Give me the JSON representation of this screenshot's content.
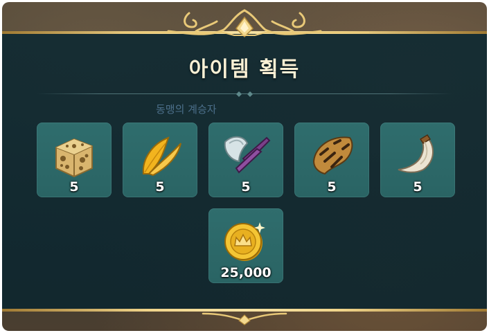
{
  "dialog": {
    "title": "아이템 획득",
    "background_label": "동맹의 계승자"
  },
  "items": [
    {
      "icon": "sponge-cube-icon",
      "quantity": "5"
    },
    {
      "icon": "golden-feather-icon",
      "quantity": "5"
    },
    {
      "icon": "axe-icon",
      "quantity": "5"
    },
    {
      "icon": "striped-fur-icon",
      "quantity": "5"
    },
    {
      "icon": "fang-horn-icon",
      "quantity": "5"
    },
    {
      "icon": "gold-coin-icon",
      "quantity": "25,000"
    }
  ],
  "colors": {
    "panel": "#10303a",
    "slot": "#2c6868",
    "gold": "#e9c978",
    "title": "#fbf1d5"
  }
}
